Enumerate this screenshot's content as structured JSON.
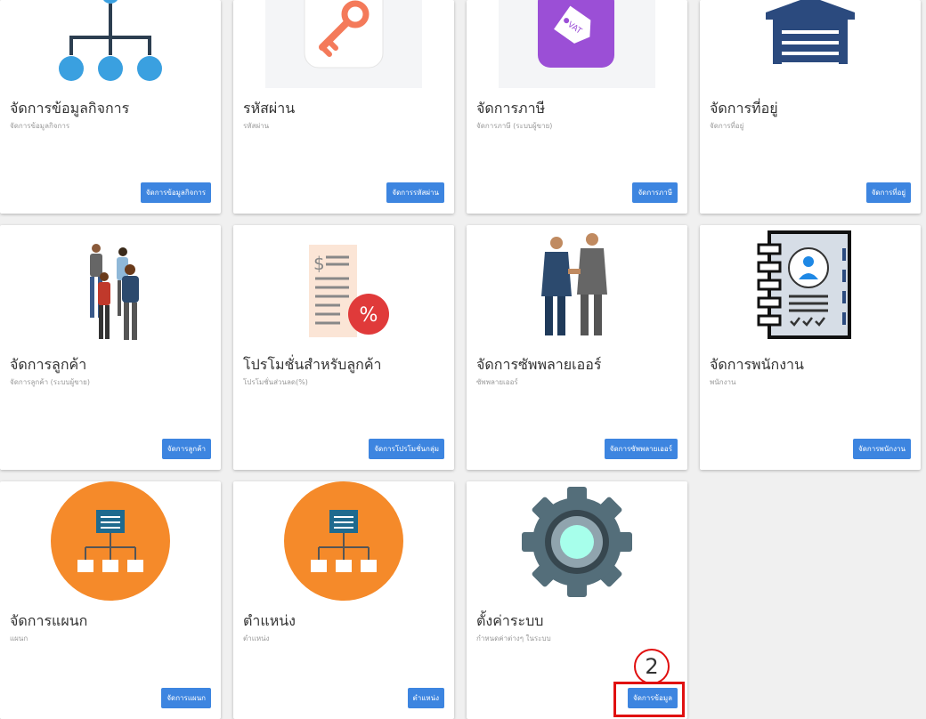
{
  "cards": [
    {
      "title": "จัดการข้อมูลกิจการ",
      "subtitle": "จัดการข้อมูลกิจการ",
      "button": "จัดการข้อมูลกิจการ",
      "icon": "org-chart-icon"
    },
    {
      "title": "รหัสผ่าน",
      "subtitle": "รหัสผ่าน",
      "button": "จัดการรหัสผ่าน",
      "icon": "key-icon"
    },
    {
      "title": "จัดการภาษี",
      "subtitle": "จัดการภาษี (ระบบผู้ขาย)",
      "button": "จัดการภาษี",
      "icon": "vat-tag-icon",
      "icon_text": "VAT"
    },
    {
      "title": "จัดการที่อยู่",
      "subtitle": "จัดการที่อยู่",
      "button": "จัดการที่อยู่",
      "icon": "warehouse-icon"
    },
    {
      "title": "จัดการลูกค้า",
      "subtitle": "จัดการลูกค้า (ระบบผู้ขาย)",
      "button": "จัดการลูกค้า",
      "icon": "customers-icon"
    },
    {
      "title": "โปรโมชั่นสำหรับลูกค้า",
      "subtitle": "โปรโมชั่นส่วนลด(%)",
      "button": "จัดการโปรโมชั่นกลุ่ม",
      "icon": "discount-receipt-icon",
      "icon_text": "%"
    },
    {
      "title": "จัดการซัพพลายเออร์",
      "subtitle": "ซัพพลายเออร์",
      "button": "จัดการซัพพลายเออร์",
      "icon": "handshake-icon"
    },
    {
      "title": "จัดการพนักงาน",
      "subtitle": "พนักงาน",
      "button": "จัดการพนักงาน",
      "icon": "employee-notebook-icon"
    },
    {
      "title": "จัดการแผนก",
      "subtitle": "แผนก",
      "button": "จัดการแผนก",
      "icon": "department-icon"
    },
    {
      "title": "ตำแหน่ง",
      "subtitle": "ตำแหน่ง",
      "button": "ตำแหน่ง",
      "icon": "position-icon"
    },
    {
      "title": "ตั้งค่าระบบ",
      "subtitle": "กำหนดค่าต่างๆ ในระบบ",
      "button": "จัดการข้อมูล",
      "icon": "gear-icon"
    }
  ],
  "annotation": {
    "step_number": "2"
  },
  "colors": {
    "button": "#3d85e0",
    "annotation": "#e01010",
    "background": "#f0f0f0"
  }
}
